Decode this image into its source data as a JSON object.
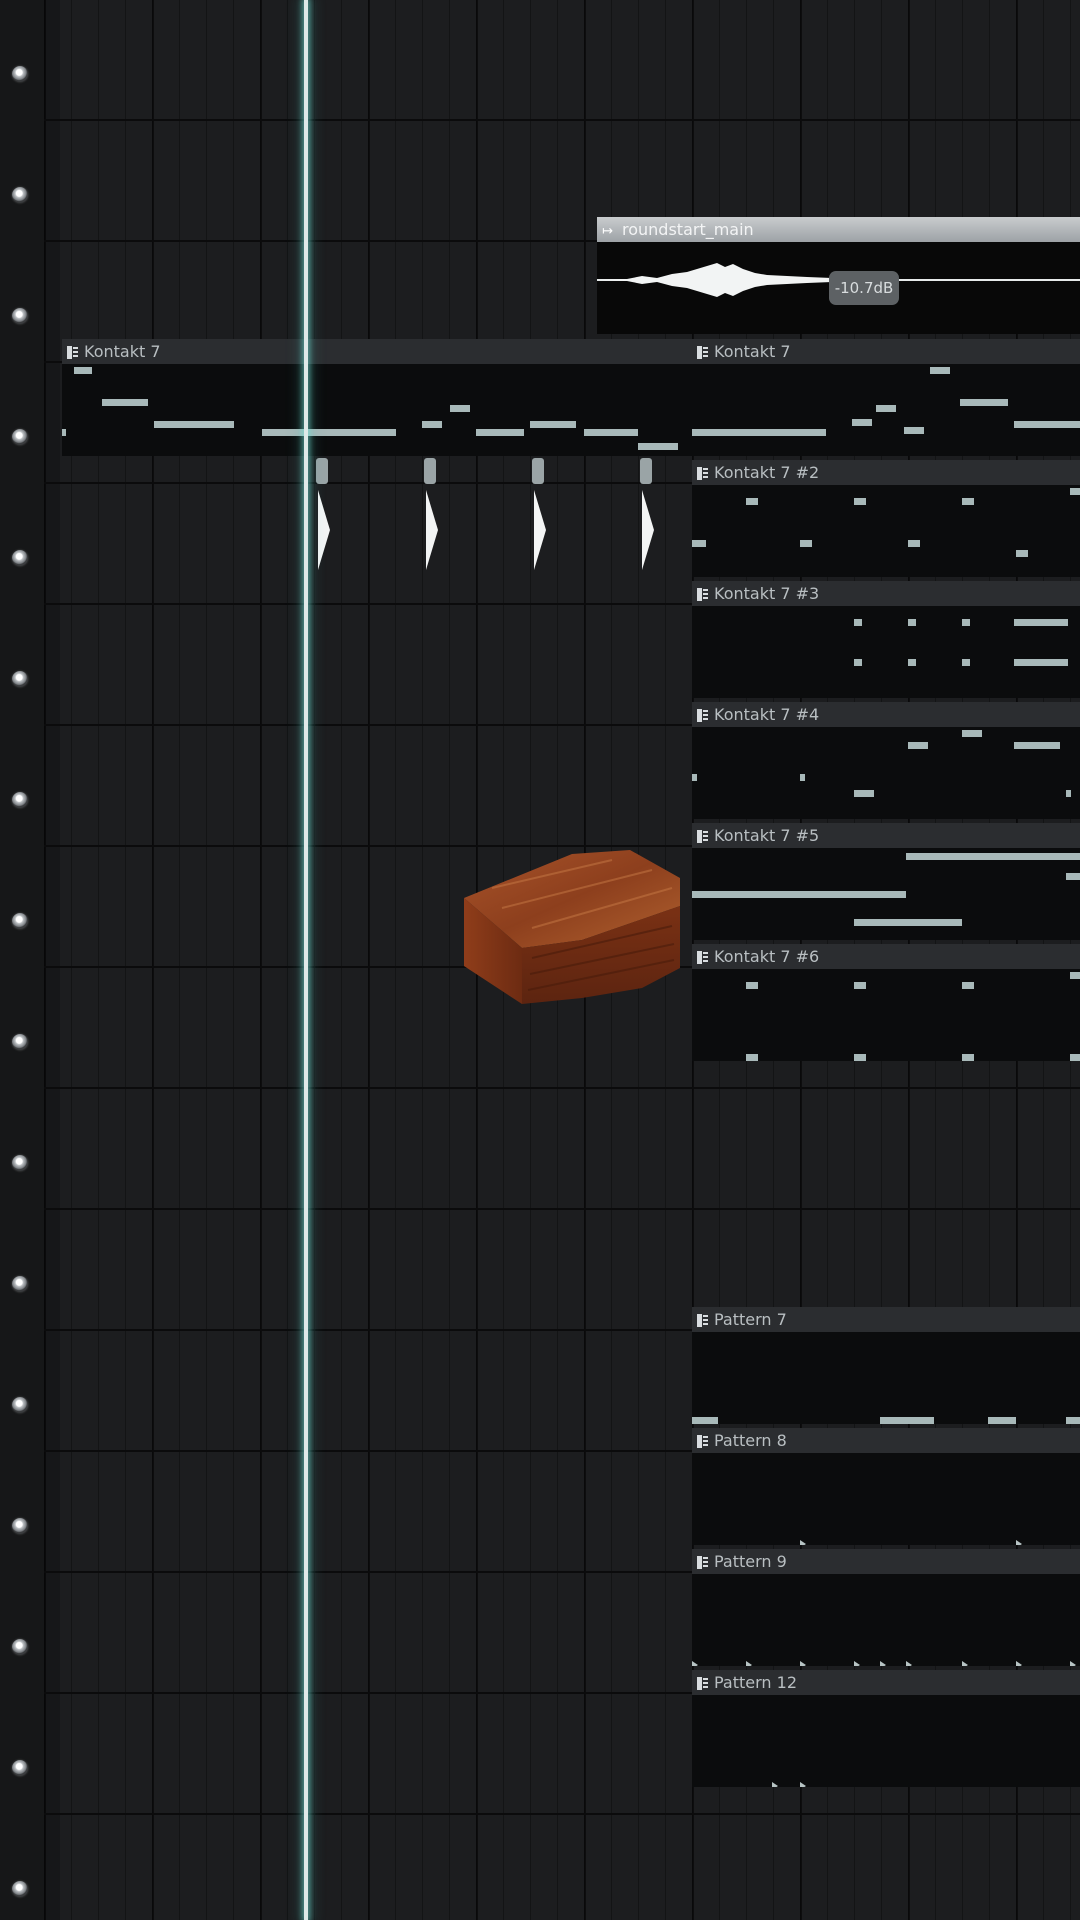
{
  "playlist": {
    "audio_clip": {
      "name": "roundstart_main",
      "gain_readout": "-10.7dB"
    },
    "clips": [
      {
        "id": "kontakt-7-a",
        "name": "Kontakt 7"
      },
      {
        "id": "kontakt-7-b",
        "name": "Kontakt 7"
      },
      {
        "id": "kontakt-7-2",
        "name": "Kontakt 7 #2"
      },
      {
        "id": "kontakt-7-3",
        "name": "Kontakt 7 #3"
      },
      {
        "id": "kontakt-7-4",
        "name": "Kontakt 7 #4"
      },
      {
        "id": "kontakt-7-5",
        "name": "Kontakt 7 #5"
      },
      {
        "id": "kontakt-7-6",
        "name": "Kontakt 7 #6"
      },
      {
        "id": "pattern-7",
        "name": "Pattern 7"
      },
      {
        "id": "pattern-8",
        "name": "Pattern 8"
      },
      {
        "id": "pattern-9",
        "name": "Pattern 9"
      },
      {
        "id": "pattern-12",
        "name": "Pattern 12"
      }
    ],
    "overlay_object": "wooden-coffin",
    "colors": {
      "background": "#1c1d1f",
      "clip_body": "#0b0c0d",
      "clip_header": "#2b2d30",
      "note": "#a8b9b9",
      "playhead": "#dfe9e8",
      "audio_header": "#b4b8bb"
    }
  }
}
